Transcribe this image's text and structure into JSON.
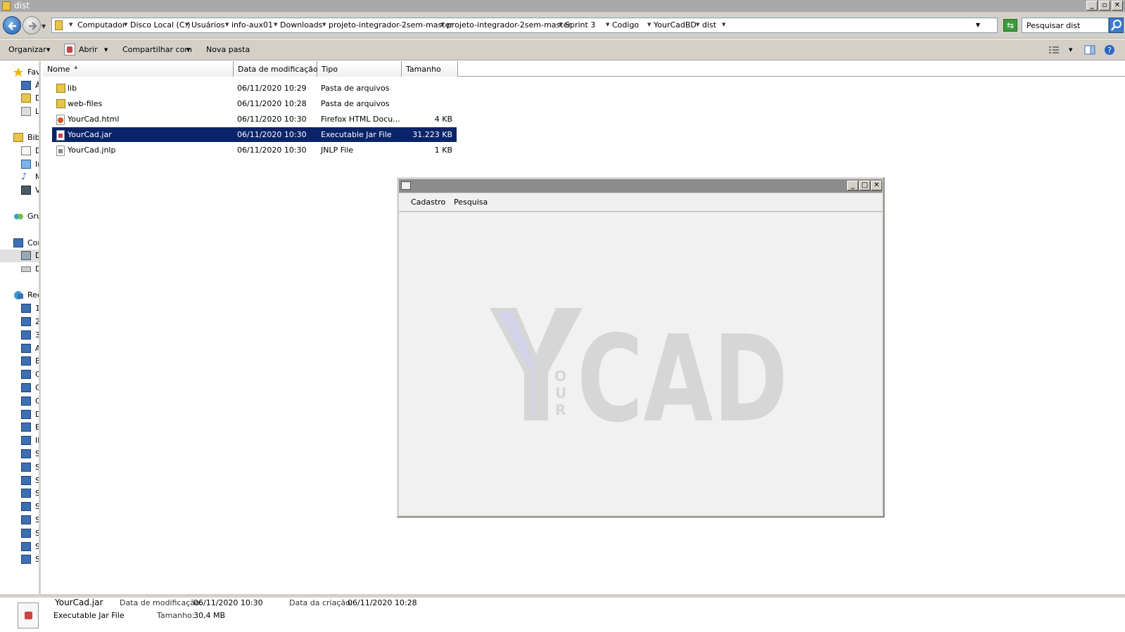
{
  "window": {
    "title": "dist"
  },
  "address": {
    "crumbs": [
      "Computador",
      "Disco Local (C:)",
      "Usuários",
      "info-aux01",
      "Downloads",
      "projeto-integrador-2sem-master",
      "projeto-integrador-2sem-master",
      "Sprint 3",
      "Codigo",
      "YourCadBD",
      "dist"
    ]
  },
  "search": {
    "value": "Pesquisar dist"
  },
  "toolbar": {
    "organize": "Organizar",
    "open": "Abrir",
    "share": "Compartilhar com",
    "new_folder": "Nova pasta"
  },
  "nav": {
    "items": [
      {
        "label": "Fav",
        "icon": "star-icon"
      },
      {
        "label": "Á",
        "icon": "desktop-icon"
      },
      {
        "label": "D",
        "icon": "downloads-icon"
      },
      {
        "label": "Lo",
        "icon": "recent-places-icon"
      },
      {
        "label": "Bibl",
        "icon": "libraries-icon"
      },
      {
        "label": "D",
        "icon": "documents-icon"
      },
      {
        "label": "Ir",
        "icon": "pictures-icon"
      },
      {
        "label": "M",
        "icon": "music-icon"
      },
      {
        "label": "V",
        "icon": "videos-icon"
      },
      {
        "label": "Gru",
        "icon": "homegroup-icon"
      },
      {
        "label": "Cor",
        "icon": "computer-icon"
      },
      {
        "label": "D",
        "icon": "local-disk-icon"
      },
      {
        "label": "D",
        "icon": "drive-icon"
      },
      {
        "label": "Rec",
        "icon": "network-icon"
      },
      {
        "label": "1",
        "icon": "network-computer-icon"
      },
      {
        "label": "2",
        "icon": "network-computer-icon"
      },
      {
        "label": "3",
        "icon": "network-computer-icon"
      },
      {
        "label": "A",
        "icon": "network-computer-icon"
      },
      {
        "label": "B",
        "icon": "network-computer-icon"
      },
      {
        "label": "C",
        "icon": "network-computer-icon"
      },
      {
        "label": "C",
        "icon": "network-computer-icon"
      },
      {
        "label": "C",
        "icon": "network-computer-icon"
      },
      {
        "label": "D",
        "icon": "network-computer-icon"
      },
      {
        "label": "E",
        "icon": "network-computer-icon"
      },
      {
        "label": "II",
        "icon": "network-computer-icon"
      },
      {
        "label": "S",
        "icon": "network-computer-icon"
      },
      {
        "label": "S",
        "icon": "network-computer-icon"
      },
      {
        "label": "S",
        "icon": "network-computer-icon"
      },
      {
        "label": "S",
        "icon": "network-computer-icon"
      },
      {
        "label": "S",
        "icon": "network-computer-icon"
      },
      {
        "label": "S",
        "icon": "network-computer-icon"
      },
      {
        "label": "S",
        "icon": "network-computer-icon"
      },
      {
        "label": "S",
        "icon": "network-computer-icon"
      },
      {
        "label": "S",
        "icon": "network-computer-icon"
      }
    ]
  },
  "columns": {
    "name": "Nome",
    "modified": "Data de modificação",
    "type": "Tipo",
    "size": "Tamanho"
  },
  "files": [
    {
      "name": "lib",
      "modified": "06/11/2020 10:29",
      "type": "Pasta de arquivos",
      "size": "",
      "icon": "folder-icon"
    },
    {
      "name": "web-files",
      "modified": "06/11/2020 10:28",
      "type": "Pasta de arquivos",
      "size": "",
      "icon": "folder-icon"
    },
    {
      "name": "YourCad.html",
      "modified": "06/11/2020 10:30",
      "type": "Firefox HTML Docu...",
      "size": "4 KB",
      "icon": "html-file-icon"
    },
    {
      "name": "YourCad.jar",
      "modified": "06/11/2020 10:30",
      "type": "Executable Jar File",
      "size": "31.223 KB",
      "icon": "jar-file-icon",
      "selected": true
    },
    {
      "name": "YourCad.jnlp",
      "modified": "06/11/2020 10:30",
      "type": "JNLP File",
      "size": "1 KB",
      "icon": "jnlp-file-icon"
    }
  ],
  "app": {
    "menu": [
      "Cadastro",
      "Pesquisa"
    ],
    "logo": {
      "main": "YCAD",
      "vertical": "OUR"
    },
    "colors": {
      "logo_gray": "#d6d6d6",
      "logo_y_accent": "#d2d2e8"
    }
  },
  "details": {
    "name": "YourCad.jar",
    "type": "Executable Jar File",
    "modified_label": "Data de modificação:",
    "modified_value": "06/11/2020 10:30",
    "created_label": "Data da criação:",
    "created_value": "06/11/2020 10:28",
    "size_label": "Tamanho:",
    "size_value": "30,4 MB"
  },
  "colors": {
    "selection": "#0a246a",
    "chrome": "#d4d0c8",
    "titlebar": "#a9a9a9"
  }
}
